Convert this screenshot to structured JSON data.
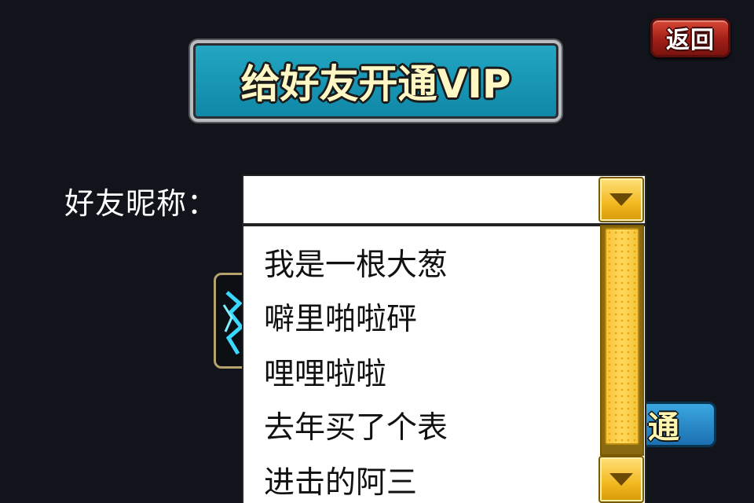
{
  "header": {
    "back_label": "返回",
    "title": "给好友开通VIP"
  },
  "form": {
    "nickname_label": "好友昵称：",
    "nickname_value": "",
    "nickname_placeholder": ""
  },
  "dropdown": {
    "items": [
      {
        "label": "我是一根大葱"
      },
      {
        "label": "噼里啪啦砰"
      },
      {
        "label": "哩哩啦啦"
      },
      {
        "label": "去年买了个表"
      },
      {
        "label": "进击的阿三"
      }
    ],
    "toggle_icon": "triangle-down-icon",
    "scroll_down_icon": "triangle-down-icon"
  },
  "actions": {
    "open_label_visible": "通"
  },
  "colors": {
    "background": "#12141b",
    "title_banner": "#1495b5",
    "title_text": "#fff8c4",
    "back_button": "#b8281d",
    "dropdown_scroll": "#f2b820",
    "open_button": "#1c6fb1"
  }
}
